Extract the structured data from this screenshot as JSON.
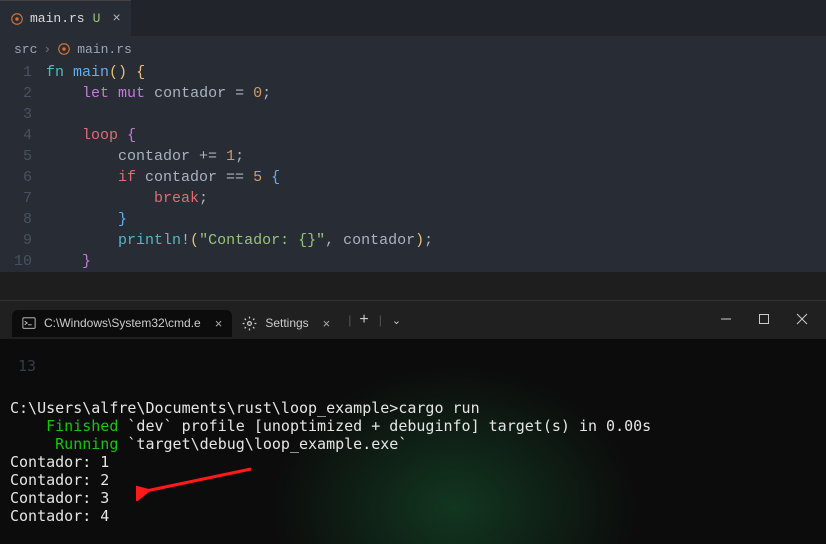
{
  "tab": {
    "filename": "main.rs",
    "modified_marker": "U"
  },
  "breadcrumbs": {
    "folder": "src",
    "file": "main.rs"
  },
  "code_lines": [
    "fn main() {",
    "    let mut contador = 0;",
    "",
    "    loop {",
    "        contador += 1;",
    "        if contador == 5 {",
    "            break;",
    "        }",
    "        println!(\"Contador: {}\", contador);",
    "    }"
  ],
  "line_numbers": [
    "1",
    "2",
    "3",
    "4",
    "5",
    "6",
    "7",
    "8",
    "9",
    "10"
  ],
  "ghost_line_numbers": [
    "",
    "13"
  ],
  "terminal": {
    "tab1": "C:\\Windows\\System32\\cmd.e",
    "tab2": "Settings",
    "prompt": "C:\\Users\\alfre\\Documents\\rust\\loop_example>",
    "command": "cargo run",
    "finished_label": "Finished",
    "finished_rest": " `dev` profile [unoptimized + debuginfo] target(s) in 0.00s",
    "running_label": "Running",
    "running_rest": " `target\\debug\\loop_example.exe`",
    "output": [
      "Contador: 1",
      "Contador: 2",
      "Contador: 3",
      "Contador: 4"
    ]
  }
}
